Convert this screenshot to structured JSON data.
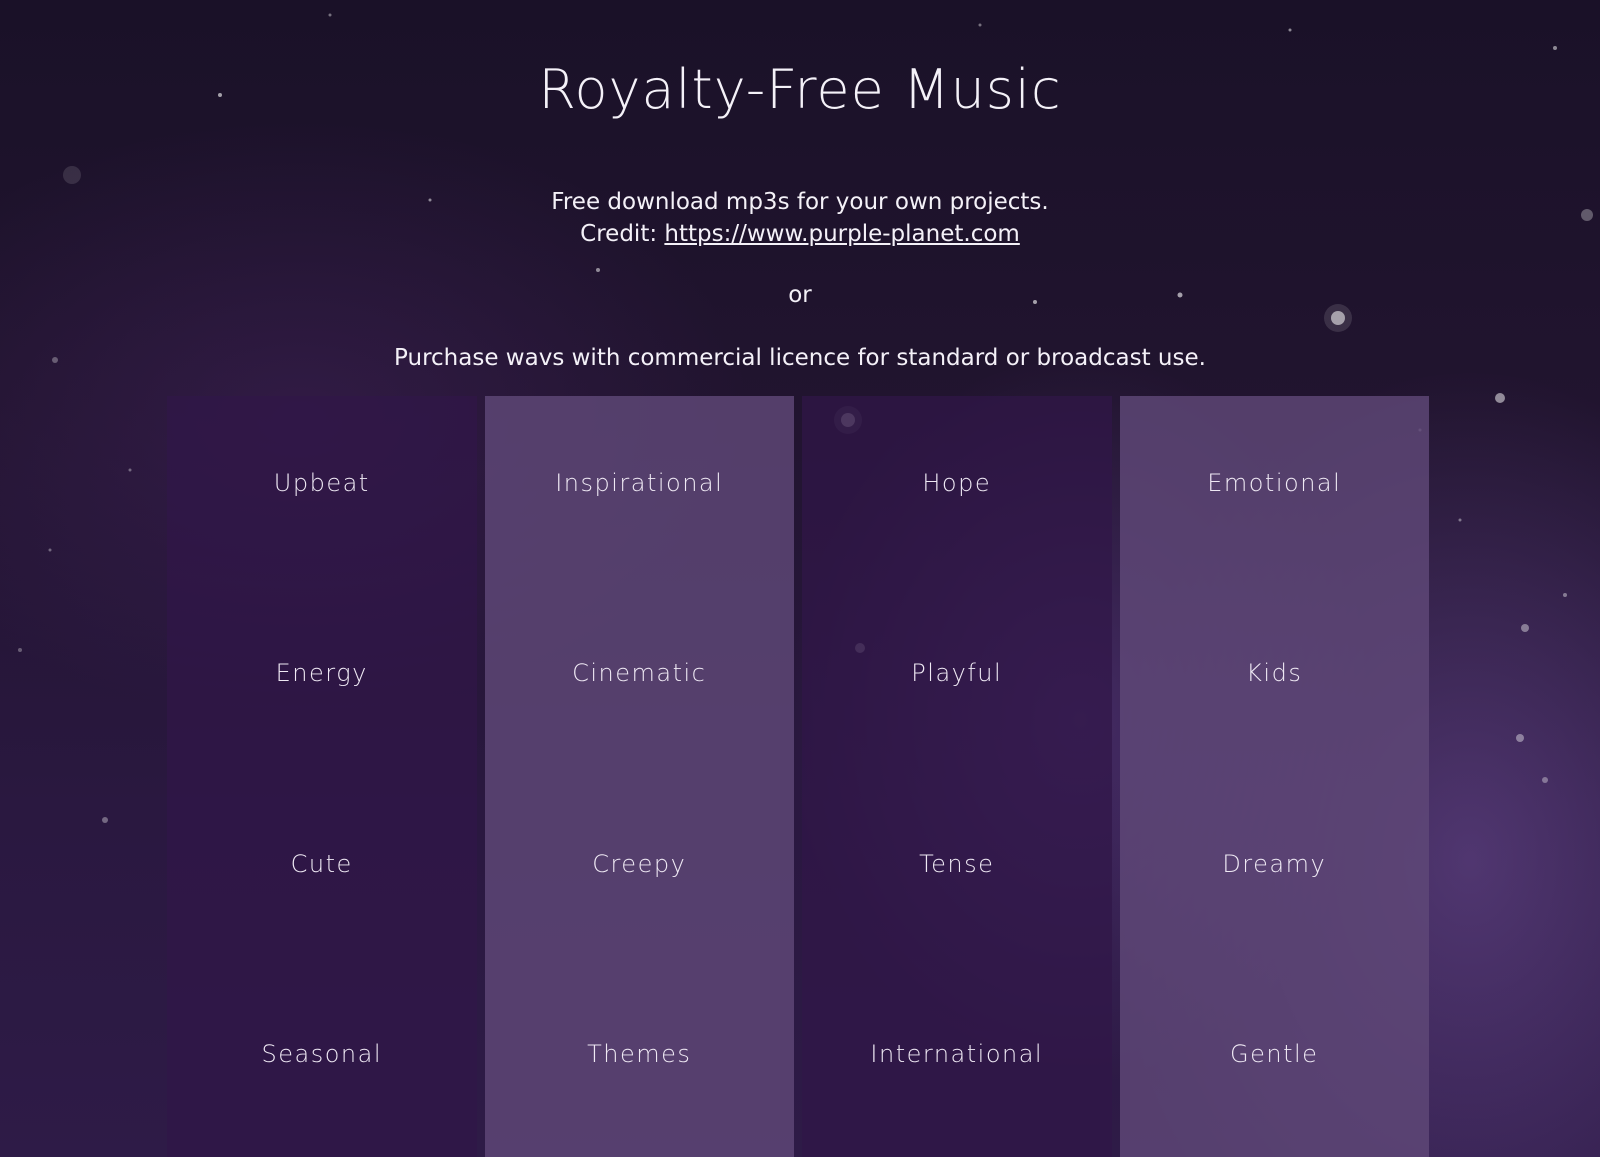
{
  "header": {
    "title": "Royalty-Free Music",
    "intro_line1": "Free download mp3s for your own projects.",
    "credit_label": "Credit: ",
    "credit_link": "https://www.purple-planet.com",
    "or_text": "or",
    "purchase_text": "Purchase wavs with commercial licence for standard or broadcast use."
  },
  "categories": {
    "columns": [
      {
        "items": [
          "Upbeat",
          "Energy",
          "Cute",
          "Seasonal"
        ]
      },
      {
        "items": [
          "Inspirational",
          "Cinematic",
          "Creepy",
          "Themes"
        ]
      },
      {
        "items": [
          "Hope",
          "Playful",
          "Tense",
          "International"
        ]
      },
      {
        "items": [
          "Emotional",
          "Kids",
          "Dreamy",
          "Gentle"
        ]
      }
    ]
  },
  "colors": {
    "background": "#1a1128",
    "column_dark": "#301648",
    "column_light": "#5f4878",
    "text": "#f4f1f8"
  }
}
